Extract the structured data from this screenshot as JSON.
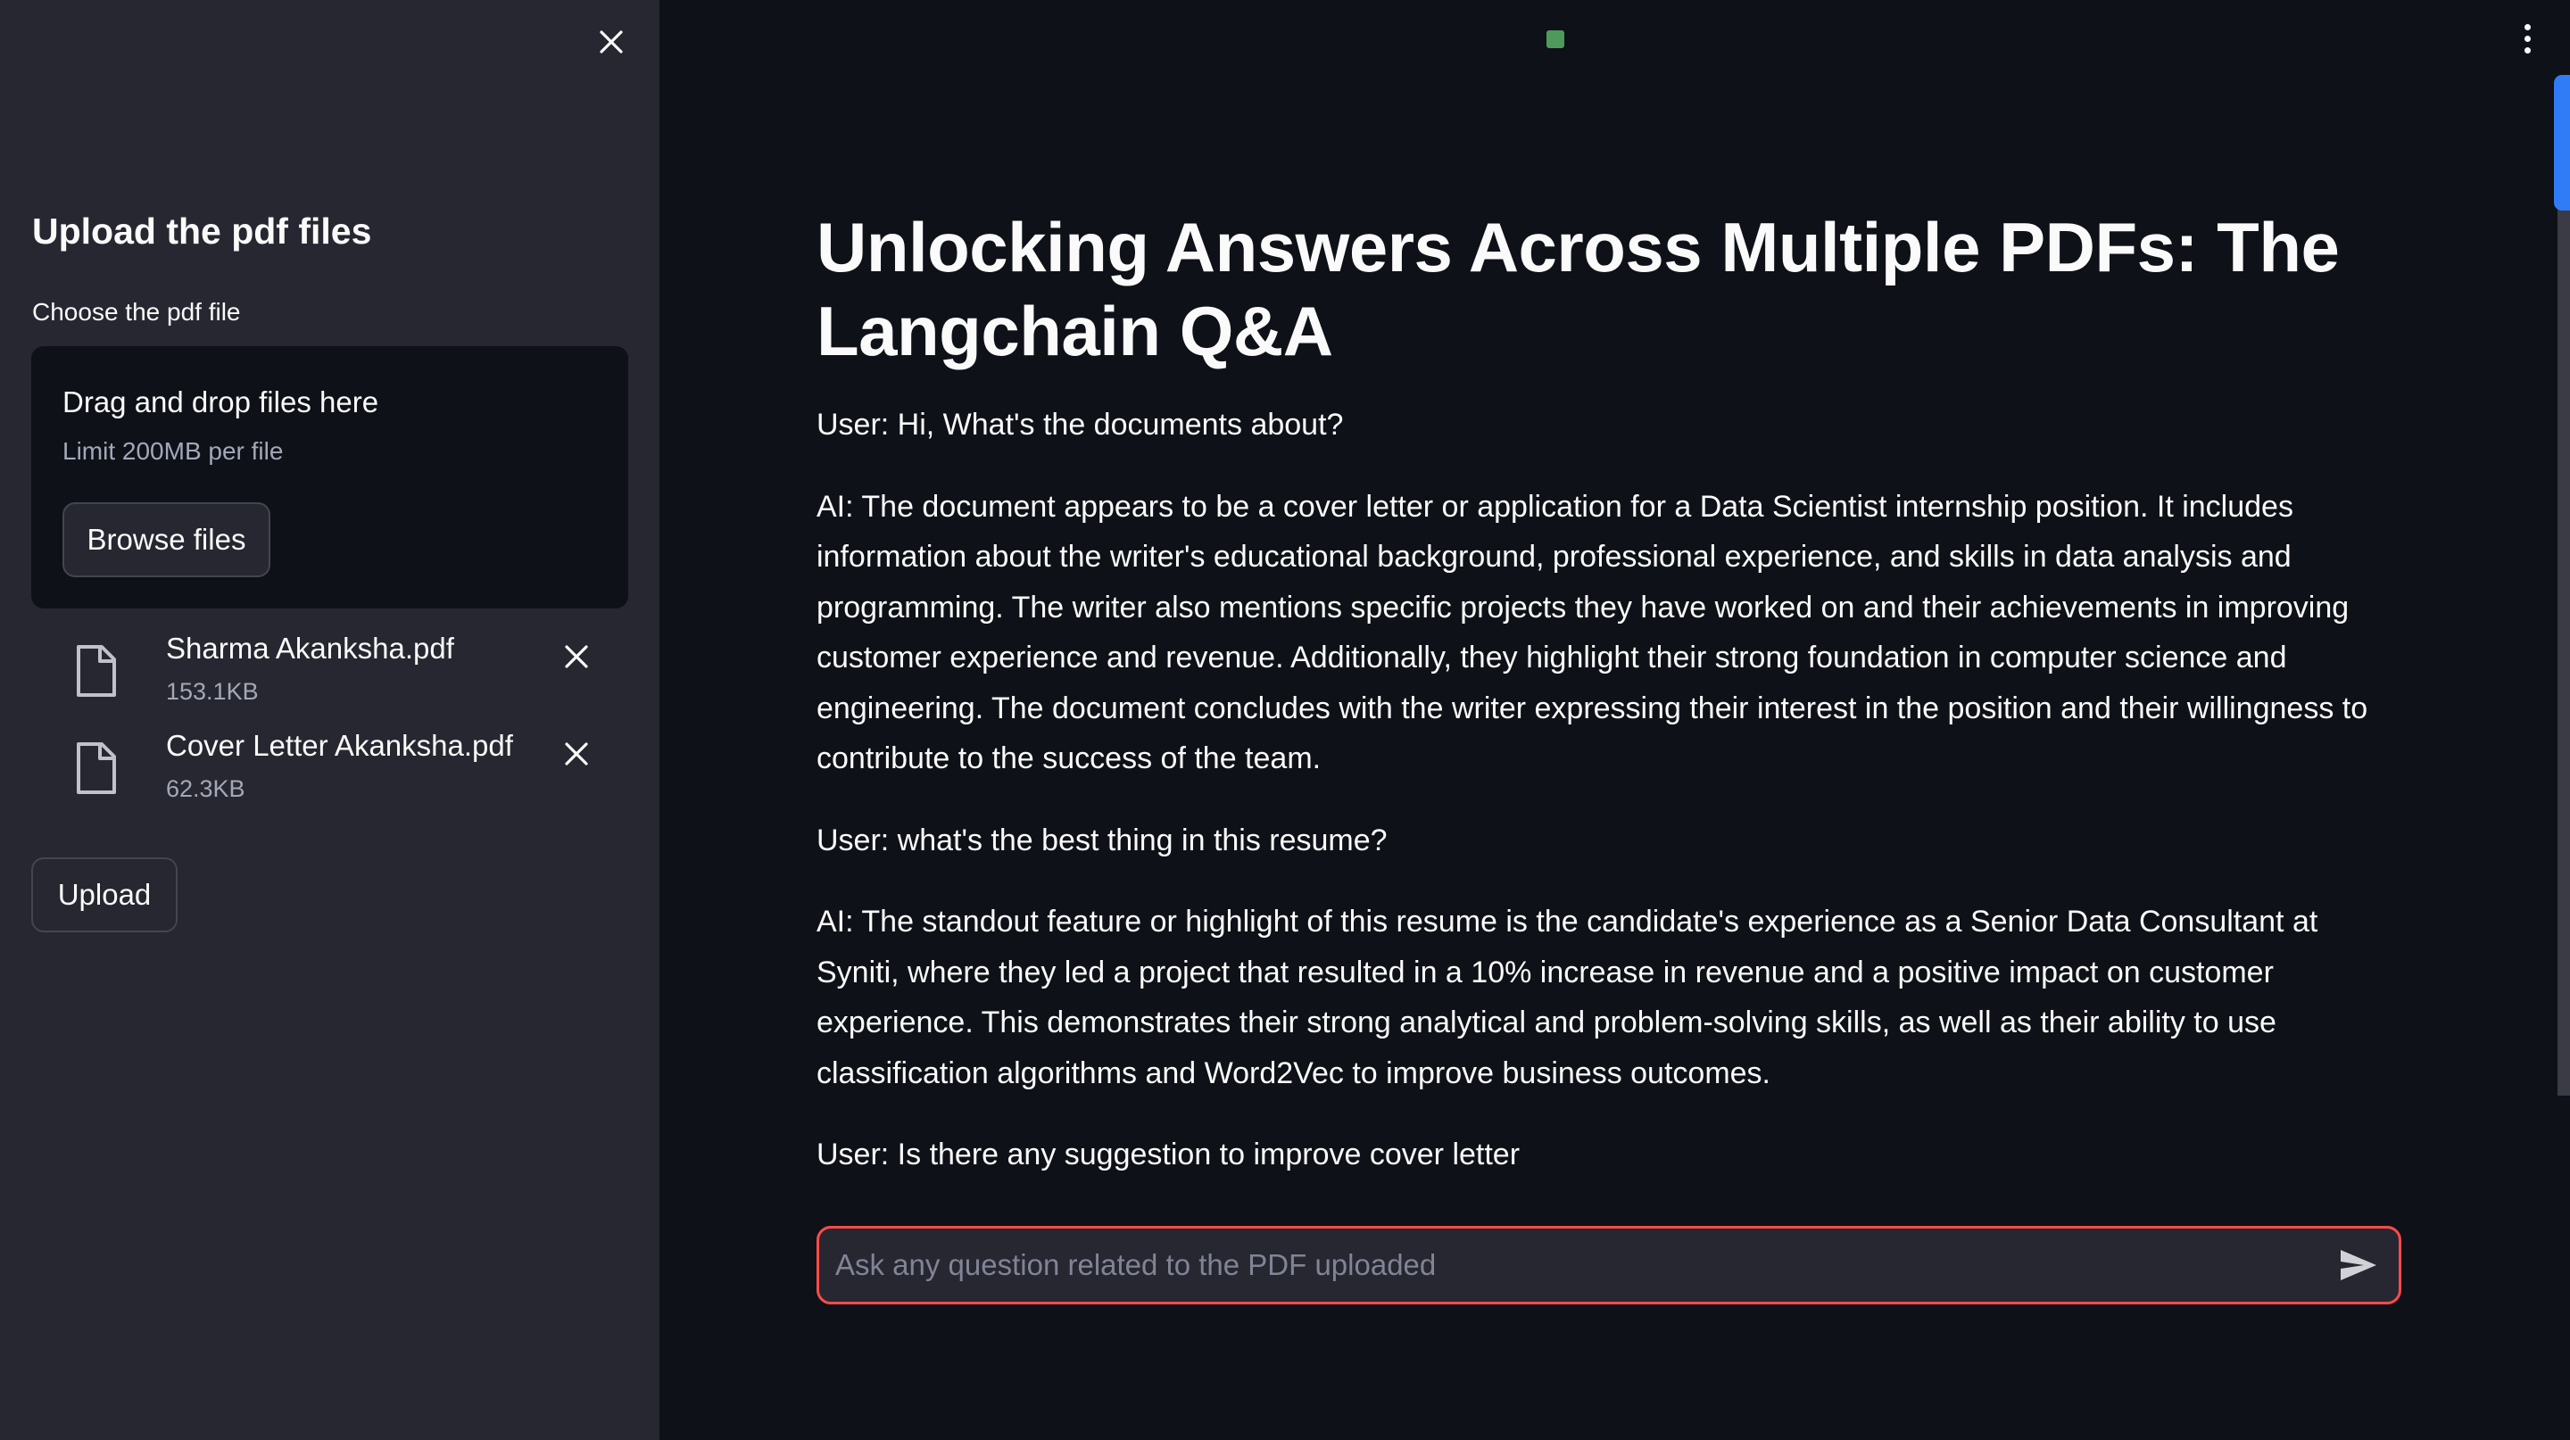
{
  "sidebar": {
    "title": "Upload the pdf files",
    "uploader_label": "Choose the pdf file",
    "dropzone": {
      "title": "Drag and drop files here",
      "limit": "Limit 200MB per file",
      "browse_label": "Browse files"
    },
    "files": [
      {
        "name": "Sharma Akanksha.pdf",
        "size": "153.1KB"
      },
      {
        "name": "Cover Letter Akanksha.pdf",
        "size": "62.3KB"
      }
    ],
    "upload_label": "Upload"
  },
  "main": {
    "title": "Unlocking Answers Across Multiple PDFs: The Langchain Q&A",
    "messages": [
      "User: Hi, What's the documents about?",
      "AI: The document appears to be a cover letter or application for a Data Scientist internship position. It includes information about the writer's educational background, professional experience, and skills in data analysis and programming. The writer also mentions specific projects they have worked on and their achievements in improving customer experience and revenue. Additionally, they highlight their strong foundation in computer science and engineering. The document concludes with the writer expressing their interest in the position and their willingness to contribute to the success of the team.",
      "User: what's the best thing in this resume?",
      "AI: The standout feature or highlight of this resume is the candidate's experience as a Senior Data Consultant at Syniti, where they led a project that resulted in a 10% increase in revenue and a positive impact on customer experience. This demonstrates their strong analytical and problem-solving skills, as well as their ability to use classification algorithms and Word2Vec to improve business outcomes.",
      "User: Is there any suggestion to improve cover letter"
    ]
  },
  "chat_input": {
    "placeholder": "Ask any question related to the PDF uploaded",
    "value": ""
  },
  "icons": {
    "close": "close-icon",
    "file": "file-icon",
    "remove": "close-icon",
    "menu": "more-vertical-icon",
    "send": "send-icon",
    "status": "running-status-icon"
  },
  "colors": {
    "background": "#0e1117",
    "sidebar": "#262730",
    "accent": "#ff4b4b",
    "scroll_thumb": "#2f7cf6",
    "status": "#4e9a5b"
  }
}
